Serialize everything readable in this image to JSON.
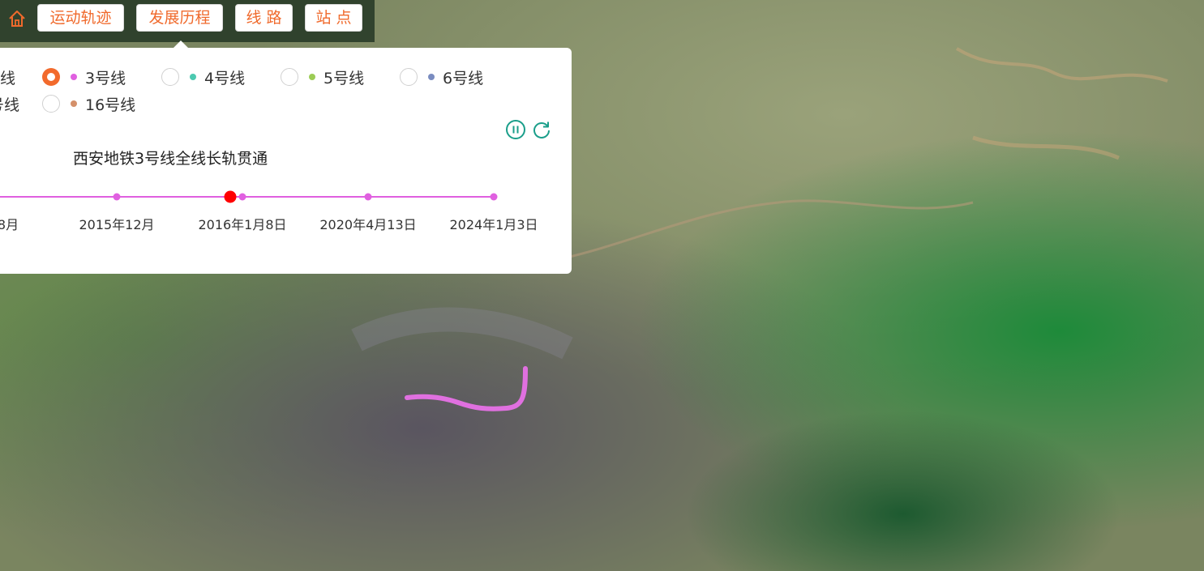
{
  "nav": {
    "home_icon": "home-icon",
    "buttons": [
      {
        "label": "运动轨迹",
        "active": false
      },
      {
        "label": "发展历程",
        "active": true
      },
      {
        "label": "线 路",
        "active": false
      },
      {
        "label": "站 点",
        "active": false
      }
    ]
  },
  "lines": {
    "row1": [
      {
        "label": "线",
        "color": "#e8e8e8",
        "selected": false,
        "clipped": true
      },
      {
        "label": "3号线",
        "color": "#e060e0",
        "selected": true
      },
      {
        "label": "4号线",
        "color": "#4cc9b0",
        "selected": false
      },
      {
        "label": "5号线",
        "color": "#9ccc55",
        "selected": false
      },
      {
        "label": "6号线",
        "color": "#7a8cc0",
        "selected": false
      }
    ],
    "row2": [
      {
        "label": "号线",
        "color": "#e8e8e8",
        "selected": false,
        "clipped": true
      },
      {
        "label": "16号线",
        "color": "#d4906a",
        "selected": false
      }
    ]
  },
  "controls": {
    "pause_icon": "pause-icon",
    "replay_icon": "replay-icon",
    "accent": "#1a9e8a"
  },
  "timeline": {
    "event_title": "西安地铁3号线全线长轨贯通",
    "line_color": "#e060e0",
    "current_marker_color": "#ff0000",
    "nodes": [
      {
        "label": "8月",
        "clipped": true
      },
      {
        "label": "2015年12月"
      },
      {
        "label": "2016年1月8日",
        "current": true
      },
      {
        "label": "2020年4月13日"
      },
      {
        "label": "2024年1月3日"
      }
    ]
  },
  "map": {
    "route_color": "#e070e0"
  }
}
